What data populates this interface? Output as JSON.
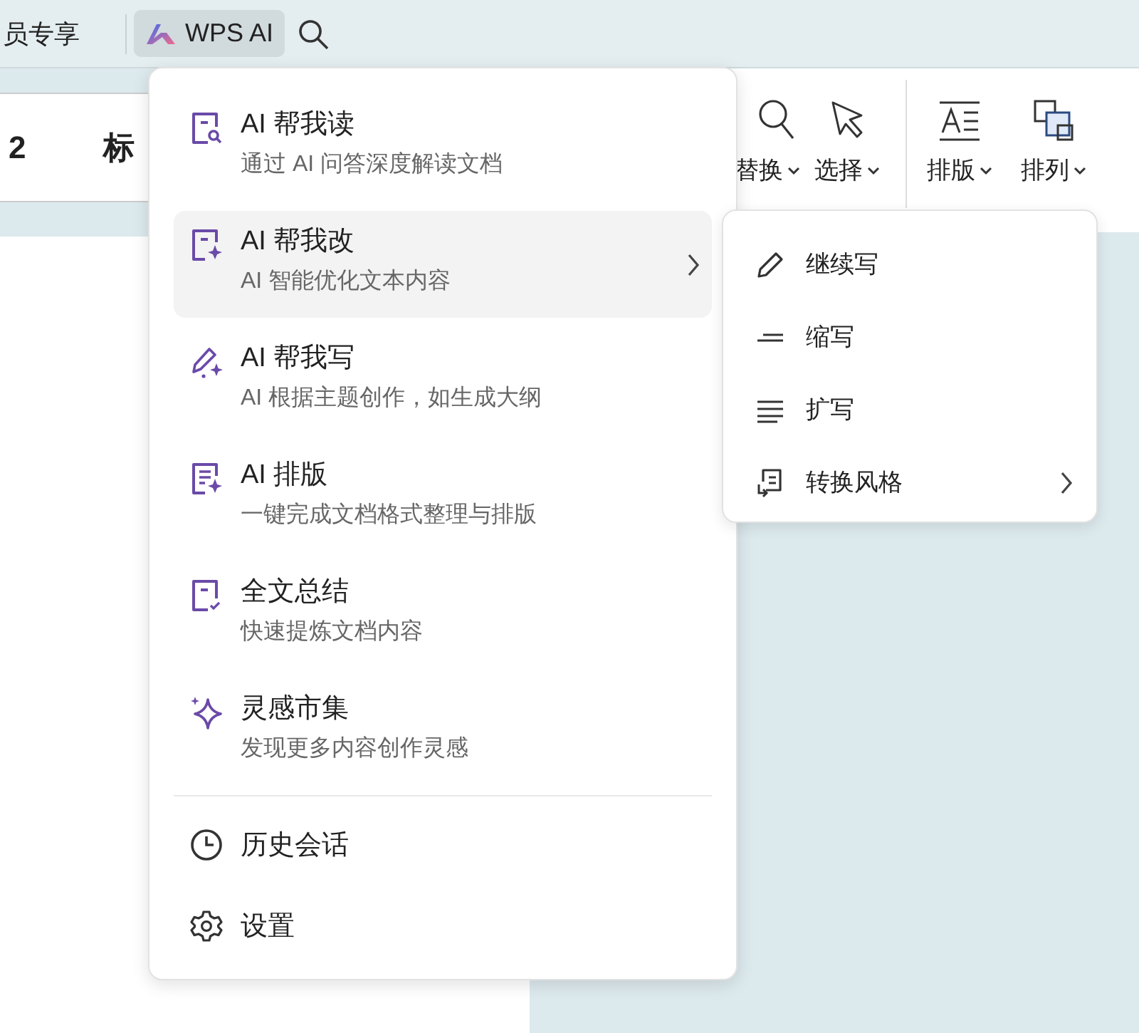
{
  "top_bar": {
    "member_label": "员专享",
    "ai_button": {
      "label": "WPS AI",
      "selected": true
    }
  },
  "ribbon": {
    "left_items": [
      "2",
      "标"
    ],
    "tools": [
      {
        "label": "替换",
        "kind": "search"
      },
      {
        "label": "选择",
        "kind": "select"
      },
      {
        "label": "排版",
        "kind": "layout"
      },
      {
        "label": "排列",
        "kind": "arrange"
      }
    ]
  },
  "ai_menu": {
    "items": [
      {
        "title": "AI 帮我读",
        "subtitle": "通过 AI 问答深度解读文档",
        "kind": "read",
        "has_submenu": false,
        "selected": false
      },
      {
        "title": "AI 帮我改",
        "subtitle": "AI 智能优化文本内容",
        "kind": "edit",
        "has_submenu": true,
        "selected": true
      },
      {
        "title": "AI 帮我写",
        "subtitle": "AI 根据主题创作，如生成大纲",
        "kind": "write",
        "has_submenu": false,
        "selected": false
      },
      {
        "title": "AI 排版",
        "subtitle": "一键完成文档格式整理与排版",
        "kind": "format",
        "has_submenu": false,
        "selected": false
      },
      {
        "title": "全文总结",
        "subtitle": "快速提炼文档内容",
        "kind": "summary",
        "has_submenu": false,
        "selected": false
      },
      {
        "title": "灵感市集",
        "subtitle": "发现更多内容创作灵感",
        "kind": "inspire",
        "has_submenu": false,
        "selected": false
      }
    ],
    "footer_items": [
      {
        "label": "历史会话",
        "kind": "history"
      },
      {
        "label": "设置",
        "kind": "settings"
      }
    ]
  },
  "submenu": {
    "items": [
      {
        "label": "继续写",
        "kind": "continue",
        "has_submenu": false
      },
      {
        "label": "缩写",
        "kind": "shorten",
        "has_submenu": false
      },
      {
        "label": "扩写",
        "kind": "expand",
        "has_submenu": false
      },
      {
        "label": "转换风格",
        "kind": "style",
        "has_submenu": true
      }
    ]
  }
}
